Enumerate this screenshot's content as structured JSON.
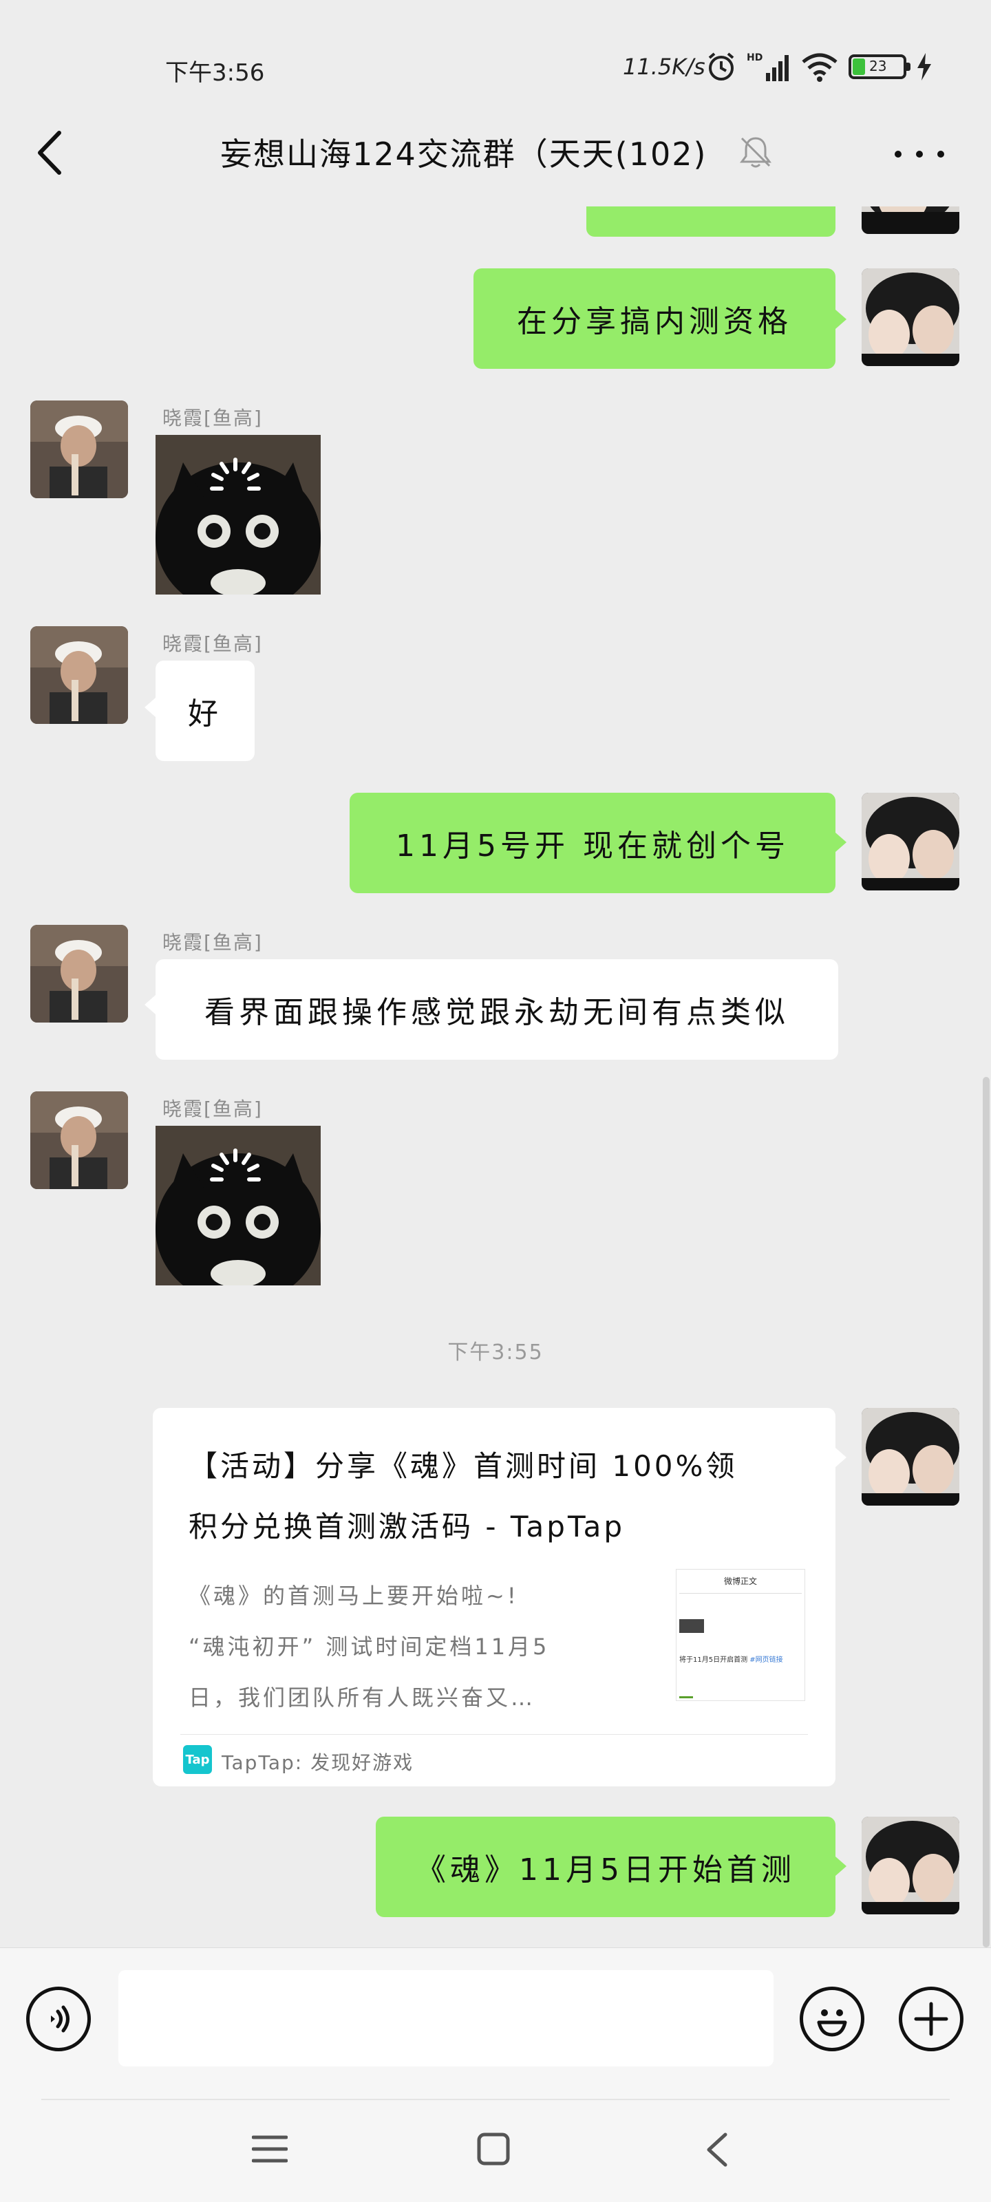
{
  "status_bar": {
    "time": "下午3:56",
    "net_speed": "11.5K/s",
    "battery": "23"
  },
  "header": {
    "title": "妄想山海124交流群（天天(102)"
  },
  "messages": {
    "m1": {
      "text": "在分享搞内测资格"
    },
    "m2": {
      "sender": "晓霞[鱼高]"
    },
    "m3": {
      "sender": "晓霞[鱼高]",
      "text": "好"
    },
    "m4": {
      "text": "11月5号开 现在就创个号"
    },
    "m5": {
      "sender": "晓霞[鱼高]",
      "text": "看界面跟操作感觉跟永劫无间有点类似"
    },
    "m6": {
      "sender": "晓霞[鱼高]"
    },
    "time_divider": "下午3:55",
    "card": {
      "title_line1": "【活动】分享《魂》首测时间 100%领",
      "title_line2": "积分兑换首测激活码 - TapTap",
      "desc_line1": "《魂》的首测马上要开始啦~!",
      "desc_line2": "“魂沌初开” 测试时间定档11月5",
      "desc_line3": "日，我们团队所有人既兴奋又…",
      "thumb_header": "微博正文",
      "thumb_text": "将于11月5日开启首测",
      "thumb_link": "#网页链接",
      "source": "TapTap: 发现好游戏",
      "source_logo": "Tap"
    },
    "m8": {
      "text": "《魂》11月5日开始首测"
    }
  },
  "colors": {
    "chat_bg": "#EDEDED",
    "bubble_green": "#95EC69",
    "bubble_white": "#FFFFFF",
    "taptap": "#15C5CE"
  },
  "icons": [
    "back-arrow-icon",
    "mute-bell-icon",
    "more-icon",
    "voice-icon",
    "emoji-icon",
    "plus-icon",
    "menu-icon",
    "home-icon",
    "back-nav-icon",
    "alarm-icon",
    "signal-icon",
    "wifi-icon",
    "battery-icon",
    "charging-icon"
  ]
}
